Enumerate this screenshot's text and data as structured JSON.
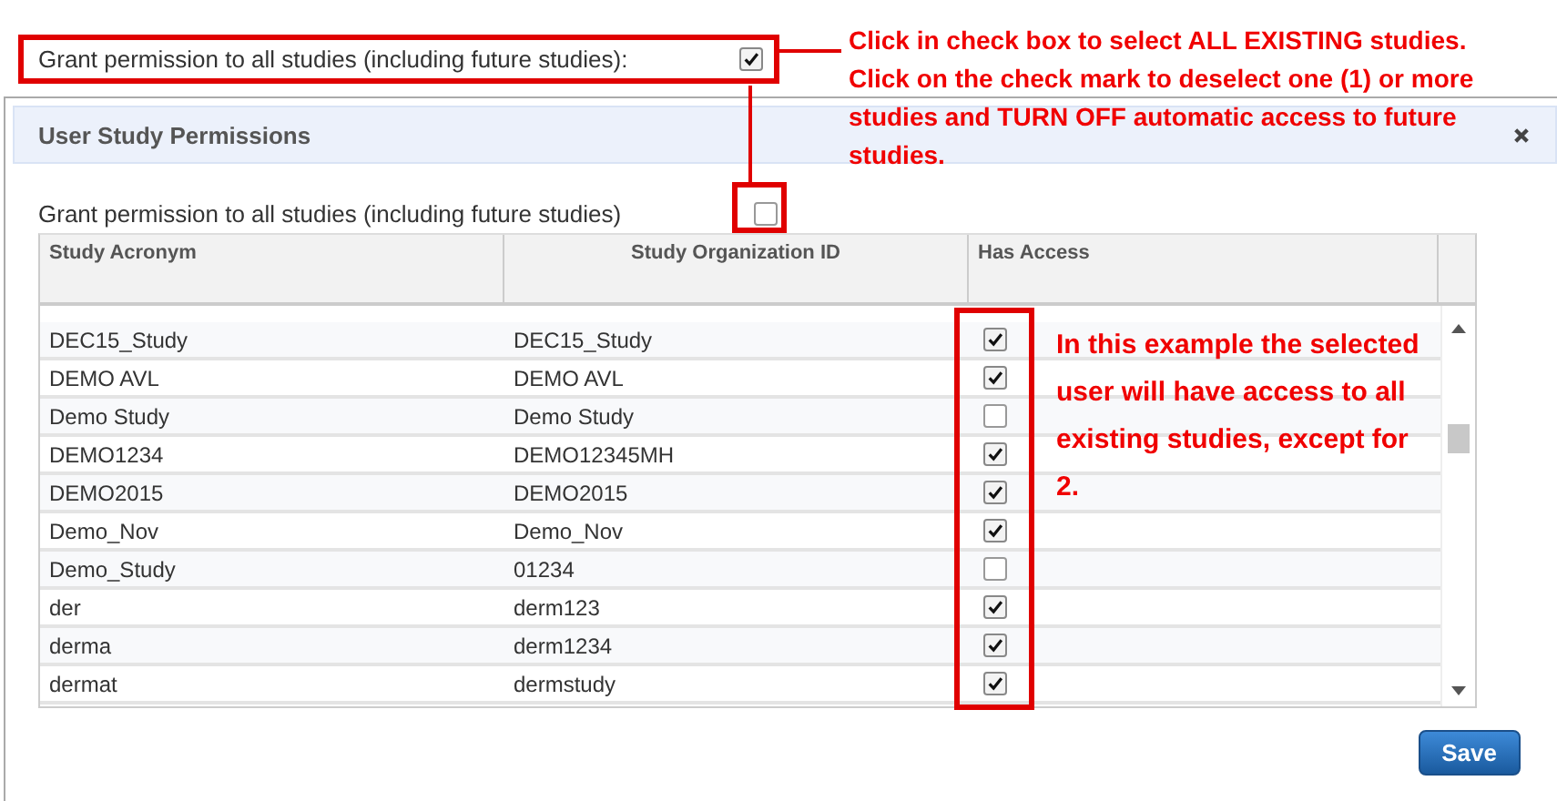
{
  "callout": {
    "label": "Grant permission to all studies (including future studies):",
    "checked": true
  },
  "annotations": [
    {
      "kind": "top",
      "text": "Click in check box to select ALL EXISTING studies.  Click on the check mark to deselect one (1) or more studies and TURN OFF automatic access to future studies."
    },
    {
      "kind": "side",
      "text": "In this example the selected user will have access to all existing studies, except for 2."
    }
  ],
  "dialog": {
    "title": "User Study Permissions",
    "grant_all": {
      "label": "Grant permission to all studies (including future studies)",
      "checked": false
    },
    "table": {
      "columns": [
        "Study Acronym",
        "Study Organization ID",
        "Has Access"
      ],
      "rows": [
        {
          "acronym": "DEC15_Study",
          "org_id": "DEC15_Study",
          "has_access": true
        },
        {
          "acronym": "DEMO AVL",
          "org_id": "DEMO AVL",
          "has_access": true
        },
        {
          "acronym": "Demo Study",
          "org_id": "Demo Study",
          "has_access": false
        },
        {
          "acronym": "DEMO1234",
          "org_id": "DEMO12345MH",
          "has_access": true
        },
        {
          "acronym": "DEMO2015",
          "org_id": "DEMO2015",
          "has_access": true
        },
        {
          "acronym": "Demo_Nov",
          "org_id": "Demo_Nov",
          "has_access": true
        },
        {
          "acronym": "Demo_Study",
          "org_id": "01234",
          "has_access": false
        },
        {
          "acronym": "der",
          "org_id": "derm123",
          "has_access": true
        },
        {
          "acronym": "derma",
          "org_id": "derm1234",
          "has_access": true
        },
        {
          "acronym": "dermat",
          "org_id": "dermstudy",
          "has_access": true
        }
      ]
    },
    "buttons": [
      {
        "label": "Save"
      }
    ]
  }
}
